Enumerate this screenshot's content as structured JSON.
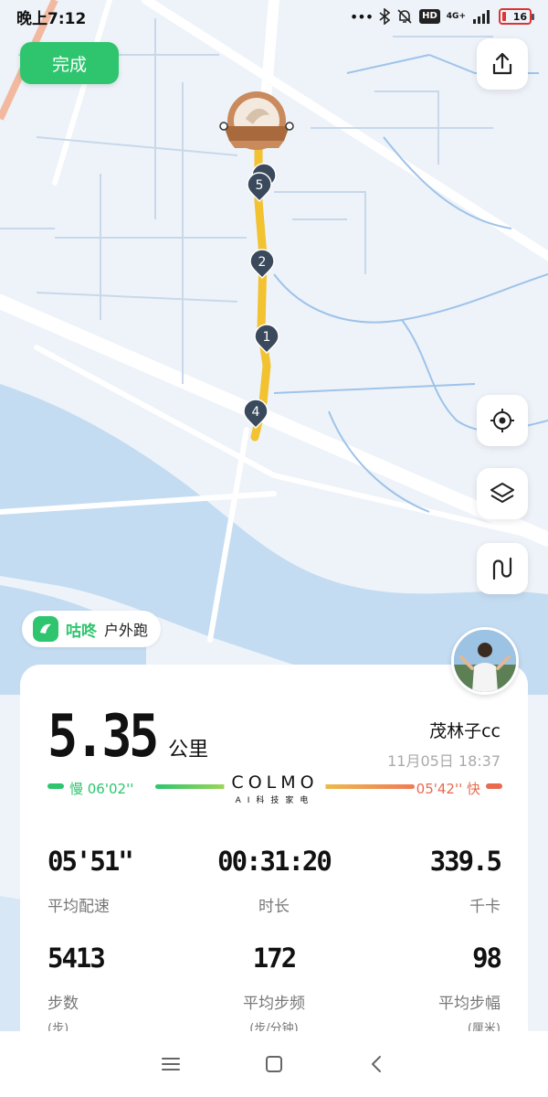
{
  "status_bar": {
    "time": "晚上7:12",
    "network": "4G+",
    "hd": "HD",
    "battery": "16"
  },
  "toolbar": {
    "done_label": "完成",
    "share_icon": "share-icon"
  },
  "map": {
    "controls": [
      "locate-icon",
      "layers-icon",
      "route-icon"
    ],
    "route_color": "#f2c230",
    "markers": [
      "5",
      "2",
      "1",
      "4"
    ],
    "finish_medal_icon": "medal-icon"
  },
  "brand": {
    "name": "咕咚",
    "activity": "户外跑",
    "color": "#2ec56e"
  },
  "summary": {
    "distance_value": "5.35",
    "distance_unit": "公里",
    "user_name": "茂林子cc",
    "date_time": "11月05日 18:37",
    "pace_slow_label": "慢 06'02''",
    "pace_fast_label": "05'42'' 快",
    "sponsor_name": "COLMO",
    "sponsor_tagline": "AI科技家电"
  },
  "stats": {
    "avg_pace": {
      "value": "05'51\"",
      "label": "平均配速"
    },
    "duration": {
      "value": "00:31:20",
      "label": "时长"
    },
    "calories": {
      "value": "339.5",
      "label": "千卡"
    },
    "steps": {
      "value": "5413",
      "label": "步数",
      "unit": "(步)"
    },
    "cadence": {
      "value": "172",
      "label": "平均步频",
      "unit": "(步/分钟)"
    },
    "stride": {
      "value": "98",
      "label": "平均步幅",
      "unit": "(厘米)"
    }
  },
  "nav": [
    "menu-icon",
    "home-icon",
    "back-icon"
  ]
}
